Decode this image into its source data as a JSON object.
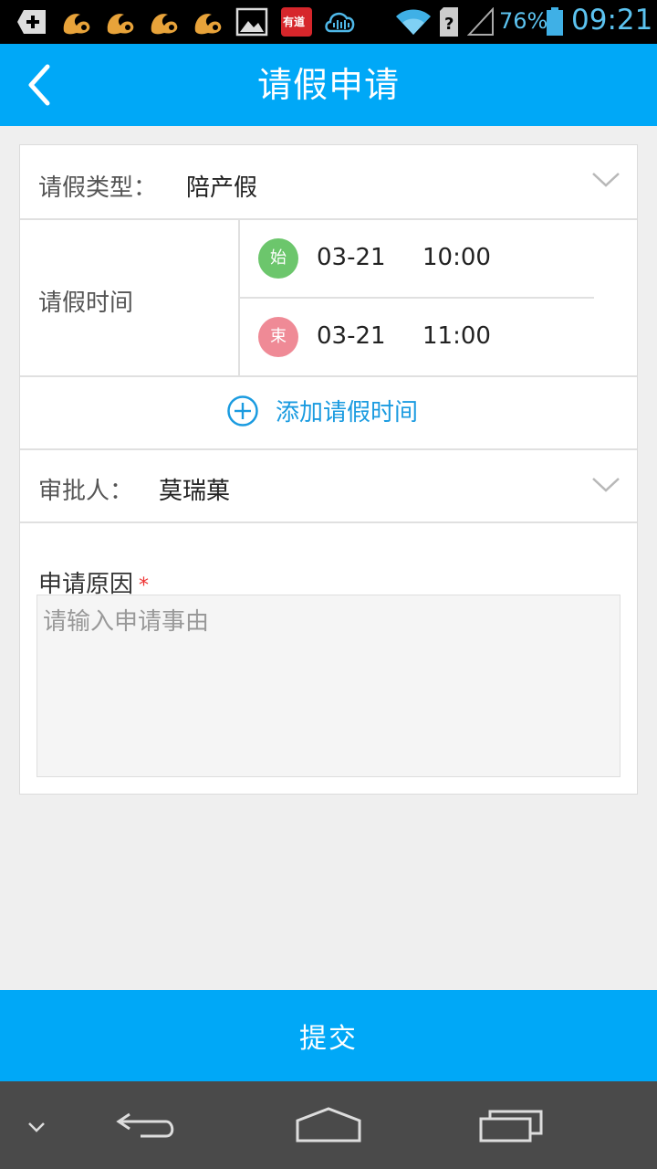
{
  "status_bar": {
    "battery": "76%",
    "time": "09:21",
    "icons": [
      "plus-badge-icon",
      "uc-browser-icon",
      "uc-browser-icon",
      "uc-browser-icon",
      "uc-browser-icon",
      "image-icon",
      "youdao-icon",
      "cloud-chat-icon",
      "wifi-icon",
      "sim-unknown-icon",
      "signal-icon",
      "battery-icon"
    ],
    "youdao_label": "有道"
  },
  "header": {
    "title": "请假申请",
    "back_icon": "chevron-left-icon"
  },
  "form": {
    "leave_type": {
      "label": "请假类型：",
      "value": "陪产假"
    },
    "leave_time": {
      "label": "请假时间",
      "start": {
        "badge": "始",
        "date": "03-21",
        "time": "10:00"
      },
      "end": {
        "badge": "束",
        "date": "03-21",
        "time": "11:00"
      }
    },
    "add_time": {
      "label": "添加请假时间"
    },
    "approver": {
      "label": "审批人：",
      "value": "莫瑞菓"
    },
    "reason": {
      "label": "申请原因",
      "required_mark": "*",
      "placeholder": "请输入申请事由",
      "value": ""
    }
  },
  "submit": {
    "label": "提交"
  },
  "nav": {
    "icons": [
      "chevron-down-icon",
      "back-icon",
      "home-icon",
      "recent-apps-icon"
    ]
  },
  "colors": {
    "primary": "#00a8f7",
    "start_badge": "#6cc66c",
    "end_badge": "#ef8a96",
    "link": "#1a9be0",
    "required": "#ee3333"
  }
}
